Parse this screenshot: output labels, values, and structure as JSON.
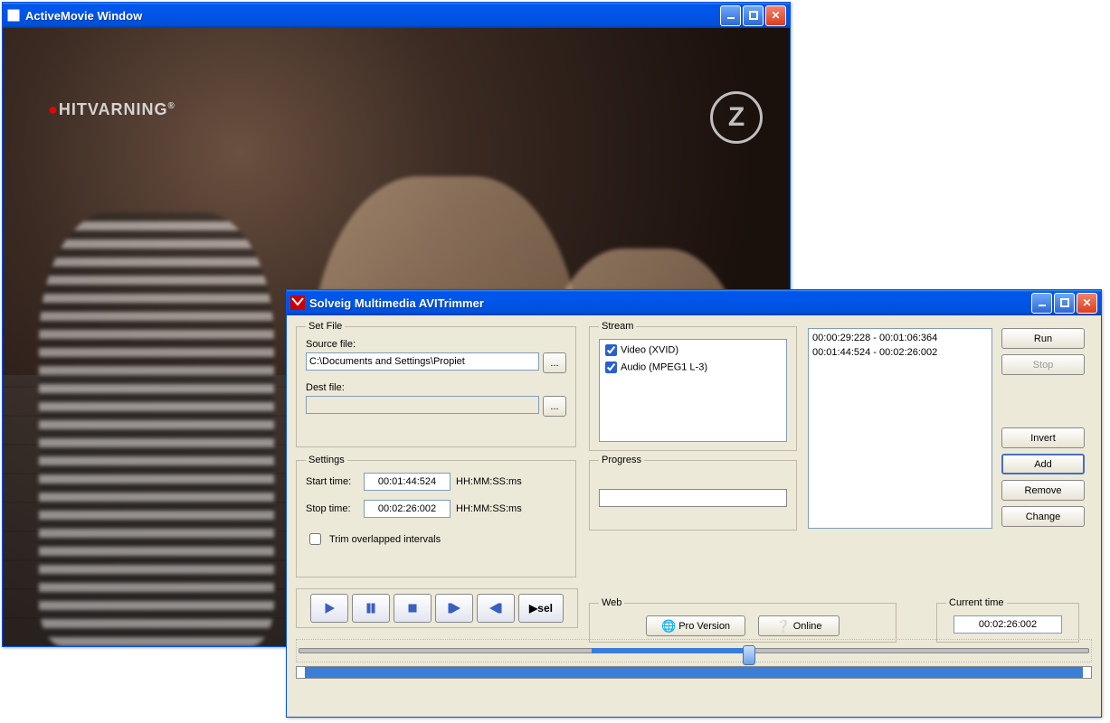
{
  "activemovie": {
    "title": "ActiveMovie Window",
    "badge_left": "HITVARNING",
    "badge_right": "Z"
  },
  "trimmer": {
    "title": "Solveig Multimedia AVITrimmer",
    "setfile": {
      "legend": "Set File",
      "source_label": "Source file:",
      "source_value": "C:\\Documents and Settings\\Propiet",
      "dest_label": "Dest file:",
      "dest_value": "",
      "browse": "..."
    },
    "settings": {
      "legend": "Settings",
      "start_label": "Start time:",
      "start_value": "00:01:44:524",
      "stop_label": "Stop time:",
      "stop_value": "00:02:26:002",
      "fmt": "HH:MM:SS:ms",
      "trim_label": "Trim overlapped intervals"
    },
    "stream": {
      "legend": "Stream",
      "items": [
        {
          "label": "Video (XVID)",
          "checked": true
        },
        {
          "label": "Audio (MPEG1 L-3)",
          "checked": true
        }
      ]
    },
    "progress": {
      "legend": "Progress"
    },
    "intervals": [
      "00:00:29:228 - 00:01:06:364",
      "00:01:44:524 - 00:02:26:002"
    ],
    "buttons": {
      "run": "Run",
      "stop": "Stop",
      "invert": "Invert",
      "add": "Add",
      "remove": "Remove",
      "change": "Change"
    },
    "web": {
      "legend": "Web",
      "pro": "Pro Version",
      "online": "Online"
    },
    "current": {
      "legend": "Current time",
      "value": "00:02:26:002"
    },
    "transport": {
      "sel": "sel"
    }
  }
}
